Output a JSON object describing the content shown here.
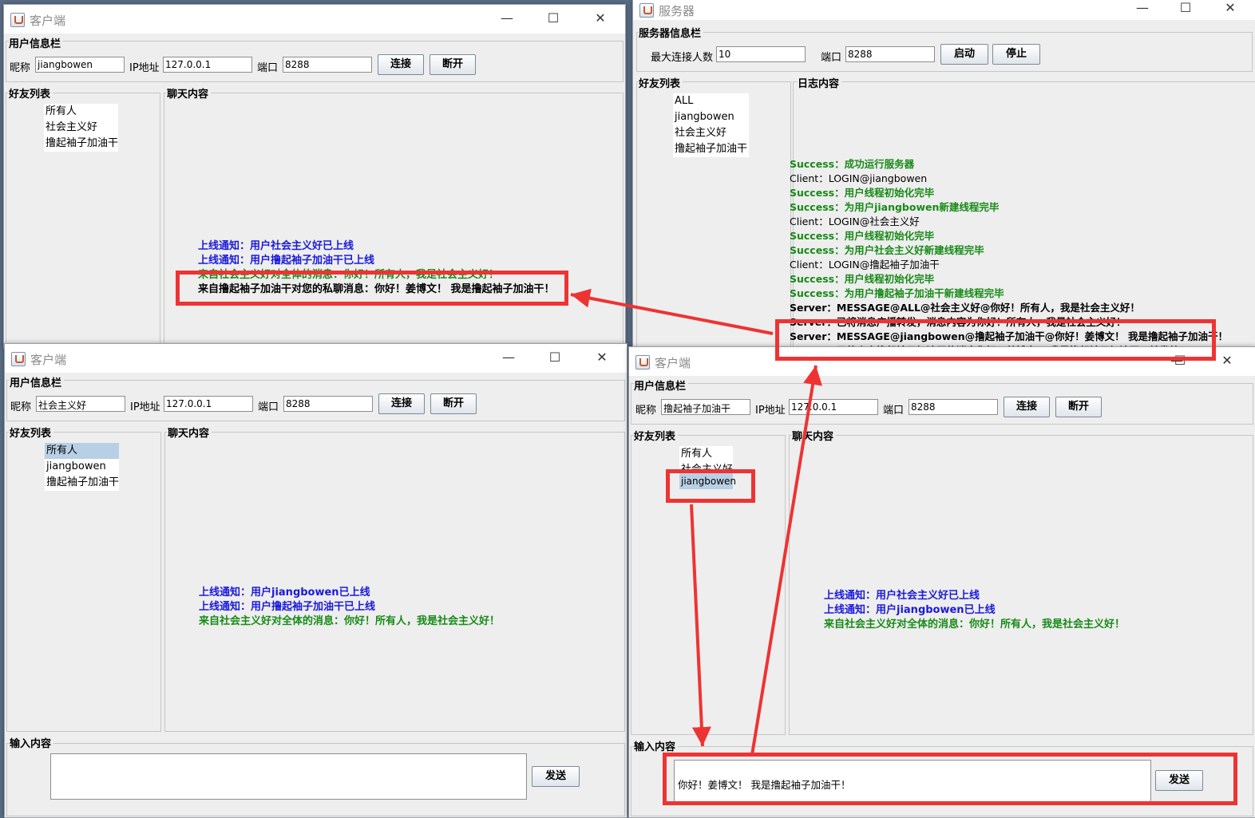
{
  "client_window_title": "客户端",
  "server_window_title": "服务器",
  "window_controls": {
    "minimize": "—",
    "maximize": "☐",
    "close": "✕"
  },
  "labels": {
    "user_info": "用户信息栏",
    "nickname": "昵称",
    "ip": "IP地址",
    "port": "端口",
    "connect": "连接",
    "disconnect": "断开",
    "friends": "好友列表",
    "chat": "聊天内容",
    "input": "输入内容",
    "send": "发送"
  },
  "colors": {
    "notice": "#1a1adb",
    "broadcast": "#178a17",
    "highlight": "#ee3333"
  },
  "client1": {
    "nickname": "jiangbowen",
    "ip": "127.0.0.1",
    "port": "8288",
    "friends": [
      "所有人",
      "社会主义好",
      "撸起袖子加油干"
    ],
    "messages": [
      "上线通知：用户社会主义好已上线",
      "上线通知：用户撸起袖子加油干已上线",
      "来自社会主义好对全体的消息：你好！所有人，我是社会主义好！",
      "来自撸起袖子加油干对您的私聊消息：你好！姜博文！ 我是撸起袖子加油干！"
    ]
  },
  "server": {
    "section": "服务器信息栏",
    "max_label": "最大连接人数",
    "max_value": "10",
    "port_label": "端口",
    "port_value": "8288",
    "start": "启动",
    "stop": "停止",
    "friends_label": "好友列表",
    "log_label": "日志内容",
    "users": [
      "ALL",
      "jiangbowen",
      "社会主义好",
      "撸起袖子加油干"
    ],
    "log": [
      "Success：成功运行服务器",
      "Client：LOGIN@jiangbowen",
      "Success：用户线程初始化完毕",
      "Success：为用户jiangbowen新建线程完毕",
      "Client：LOGIN@社会主义好",
      "Success：用户线程初始化完毕",
      "Success：为用户社会主义好新建线程完毕",
      "Client：LOGIN@撸起袖子加油干",
      "Success：用户线程初始化完毕",
      "Success：为用户撸起袖子加油干新建线程完毕",
      "Server：MESSAGE@ALL@社会主义好@你好！所有人，我是社会主义好！",
      "Server：已将消息广播转发，消息内容为你好！所有人，我是社会主义好！",
      "Server：MESSAGE@jiangbowen@撸起袖子加油干@你好！姜博文！ 我是撸起袖子加油干！",
      "Server：已将来自撸起袖子加油干的消息你好！姜博文！ 我是撸起袖子加油干！转发给jiangbowen"
    ]
  },
  "client2": {
    "nickname": "社会主义好",
    "ip": "127.0.0.1",
    "port": "8288",
    "friends": [
      "所有人",
      "jiangbowen",
      "撸起袖子加油干"
    ],
    "messages": [
      "上线通知：用户jiangbowen已上线",
      "上线通知：用户撸起袖子加油干已上线",
      "来自社会主义好对全体的消息：你好！所有人，我是社会主义好！"
    ],
    "input_text": ""
  },
  "client3": {
    "nickname": "撸起袖子加油干",
    "ip": "127.0.0.1",
    "port": "8288",
    "friends": [
      "所有人",
      "社会主义好",
      "jiangbowen"
    ],
    "messages": [
      "上线通知：用户社会主义好已上线",
      "上线通知：用户jiangbowen已上线",
      "来自社会主义好对全体的消息：你好！所有人，我是社会主义好！"
    ],
    "input_text": "你好！姜博文！ 我是撸起袖子加油干！"
  }
}
